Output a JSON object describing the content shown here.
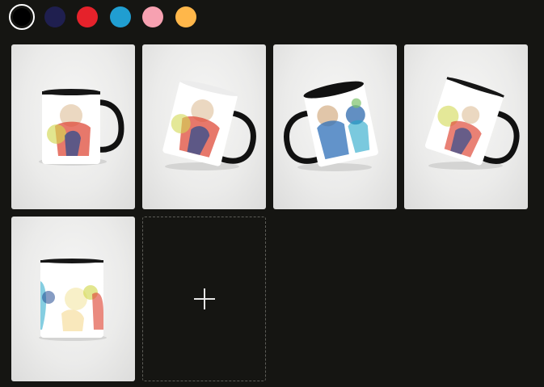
{
  "color_swatches": [
    {
      "name": "black",
      "color": "#000000",
      "selected": true
    },
    {
      "name": "navy",
      "color": "#1f1f4f",
      "selected": false
    },
    {
      "name": "red",
      "color": "#e5222b",
      "selected": false
    },
    {
      "name": "blue",
      "color": "#209ed1",
      "selected": false
    },
    {
      "name": "pink",
      "color": "#f7a1b1",
      "selected": false
    },
    {
      "name": "amber",
      "color": "#ffb74a",
      "selected": false
    }
  ],
  "product_images": [
    {
      "view": "front-right-handle",
      "accent_color": "#000000"
    },
    {
      "view": "tilted-left",
      "accent_color": "#000000"
    },
    {
      "view": "tilted-left-handle-left",
      "accent_color": "#000000"
    },
    {
      "view": "tilted-right",
      "accent_color": "#000000"
    },
    {
      "view": "front-no-handle",
      "accent_color": "#000000"
    }
  ],
  "add_image": {
    "icon": "plus-icon"
  }
}
